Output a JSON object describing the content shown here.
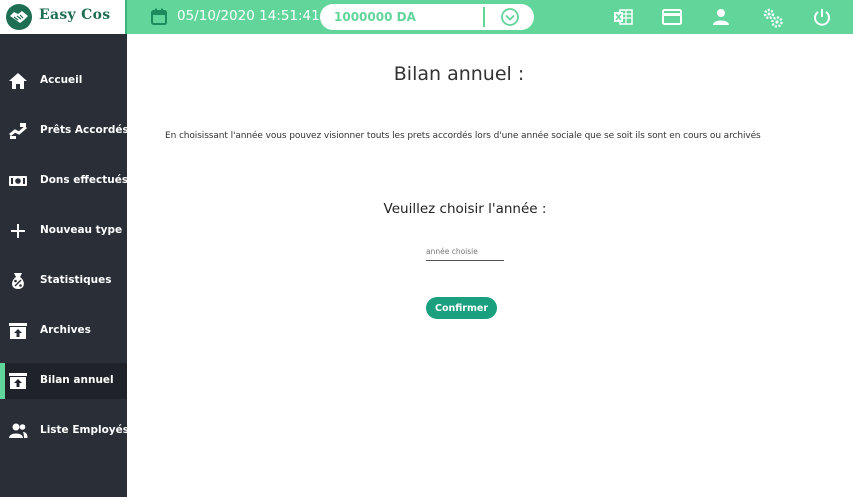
{
  "app": {
    "logo_text": "Easy Cos"
  },
  "topbar": {
    "datetime": "05/10/2020 14:51:41",
    "amount": "1000000 DA",
    "icons": [
      "excel-icon",
      "card-icon",
      "user-icon",
      "settings-icon",
      "power-icon"
    ]
  },
  "sidebar": {
    "items": [
      {
        "label": "Accueil",
        "icon": "home-icon",
        "active": false
      },
      {
        "label": "Prêts Accordés",
        "icon": "loan-icon",
        "active": false
      },
      {
        "label": "Dons effectués",
        "icon": "money-icon",
        "active": false
      },
      {
        "label": "Nouveau type",
        "icon": "plus-icon",
        "active": false
      },
      {
        "label": "Statistiques",
        "icon": "stats-icon",
        "active": false
      },
      {
        "label": "Archives",
        "icon": "archive-icon",
        "active": false
      },
      {
        "label": "Bilan annuel",
        "icon": "archive-icon",
        "active": true
      },
      {
        "label": "Liste Employés",
        "icon": "people-icon",
        "active": false
      }
    ]
  },
  "main": {
    "title": "Bilan annuel  :",
    "description": "En choisissant l'année vous pouvez visionner touts les prets accordés lors d'une année sociale que se soit ils sont en cours ou archivés",
    "prompt": "Veuillez choisir l'année :",
    "year_input": {
      "placeholder": "année choisie",
      "value": ""
    },
    "confirm_label": "Confirmer"
  },
  "colors": {
    "accent": "#62d59b",
    "sidebar_bg": "#2a2e36",
    "button": "#1aa07f",
    "logo": "#1d6e52"
  }
}
